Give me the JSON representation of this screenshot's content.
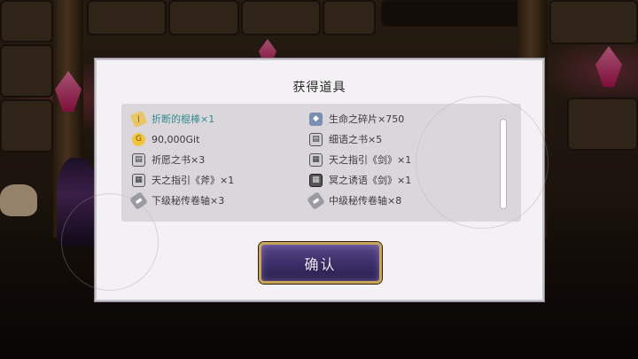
{
  "dialog": {
    "title": "获得道具",
    "confirm_label": "确认"
  },
  "items": [
    {
      "name": "折断的棍棒×1",
      "icon": "stick-icon",
      "highlight": true
    },
    {
      "name": "生命之碎片×750",
      "icon": "fragment-icon"
    },
    {
      "name": "90,000Git",
      "icon": "coin-icon"
    },
    {
      "name": "细语之书×5",
      "icon": "book-icon"
    },
    {
      "name": "祈愿之书×3",
      "icon": "book-icon"
    },
    {
      "name": "天之指引《剑》×1",
      "icon": "guide-book-icon"
    },
    {
      "name": "天之指引《斧》×1",
      "icon": "guide-book-icon"
    },
    {
      "name": "冥之诱语《剑》×1",
      "icon": "dark-book-icon"
    },
    {
      "name": "下级秘传卷轴×3",
      "icon": "scroll-icon"
    },
    {
      "name": "中级秘传卷轴×8",
      "icon": "scroll-icon"
    }
  ],
  "colors": {
    "highlight_text": "#2f8c8c",
    "button_border": "#c9a557",
    "button_fill": "#3d2f6a"
  }
}
